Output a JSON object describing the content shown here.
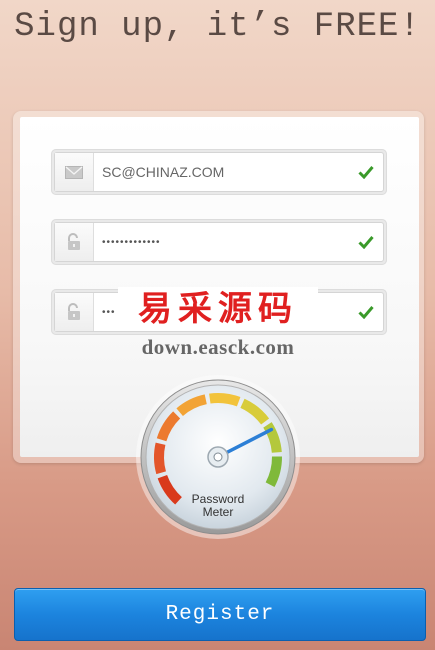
{
  "header": {
    "title": "Sign up, it’s FREE!"
  },
  "form": {
    "email": {
      "value": "SC@CHINAZ.COM",
      "icon": "envelope-icon",
      "valid": true
    },
    "password": {
      "value": "•••••••••••••",
      "icon": "padlock-icon",
      "valid": true
    },
    "confirm_password": {
      "value": "•••",
      "icon": "padlock-icon",
      "valid": true
    }
  },
  "watermark": {
    "chinese": "易采源码",
    "url": "down.easck.com"
  },
  "password_meter": {
    "line1": "Password",
    "line2": "Meter",
    "level": 0.78
  },
  "actions": {
    "register_label": "Register"
  },
  "colors": {
    "accent": "#1c84de",
    "check": "#3a9a2a",
    "title": "#5a4a44"
  }
}
